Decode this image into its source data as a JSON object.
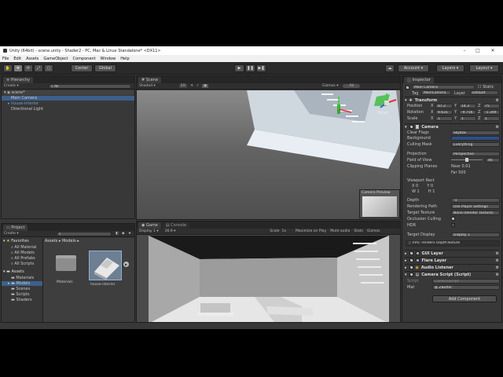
{
  "window": {
    "title": "Unity (64bit) - scene.unity - Shader2 - PC, Mac & Linux Standalone* <DX11>"
  },
  "menu": [
    "File",
    "Edit",
    "Assets",
    "GameObject",
    "Component",
    "Window",
    "Help"
  ],
  "toolbar": {
    "center": "Center",
    "global": "Global",
    "account": "Account",
    "layers": "Layers",
    "layout": "Layout"
  },
  "hierarchy": {
    "tab": "Hierarchy",
    "create": "Create",
    "search_placeholder": "All",
    "scene": "scene*",
    "items": [
      "Main Camera",
      "house-interior",
      "Directional Light"
    ]
  },
  "scene_view": {
    "tab": "Scene",
    "shading": "Shaded",
    "gizmos": "Gizmos",
    "gizmos_filter": "All",
    "persp": "Persp",
    "camera_preview": "Camera Preview"
  },
  "game_view": {
    "tabs": [
      "Game",
      "Console"
    ],
    "display": "Display 1",
    "aspect": "16:9",
    "scale": "1x",
    "options": [
      "Maximize on Play",
      "Mute audio",
      "Stats",
      "Gizmos"
    ]
  },
  "project": {
    "tab": "Project",
    "create": "Create",
    "favorites_label": "Favorites",
    "favorites": [
      "All Material",
      "All Models",
      "All Prefabs",
      "All Scripts"
    ],
    "assets_label": "Assets",
    "assets": [
      "Materials",
      "Models",
      "Scenes",
      "Scripts",
      "Shaders"
    ],
    "breadcrumb": [
      "Assets",
      "Models"
    ],
    "files": [
      "Materials",
      "house-interior"
    ]
  },
  "inspector": {
    "tab": "Inspector",
    "object_name": "Main Camera",
    "static": "Static",
    "tag_label": "Tag",
    "tag": "MainCamera",
    "layer_label": "Layer",
    "layer": "Default",
    "transform": {
      "title": "Transform",
      "position_label": "Position",
      "rotation_label": "Rotation",
      "scale_label": "Scale",
      "position": [
        "87.2",
        "14.3",
        "75"
      ],
      "rotation": [
        "9.631",
        "-9.756",
        "-1.349"
      ],
      "scale": [
        "1",
        "1",
        "1"
      ]
    },
    "camera": {
      "title": "Camera",
      "fields": [
        {
          "label": "Clear Flags",
          "value": "Skybox"
        },
        {
          "label": "Background",
          "value": ""
        },
        {
          "label": "Culling Mask",
          "value": "Everything"
        },
        {
          "label": "Projection",
          "value": "Perspective"
        },
        {
          "label": "Field of View",
          "value": "46"
        },
        {
          "label": "Clipping Planes",
          "value": "Near  0.01"
        },
        {
          "label": "",
          "value": "Far   500"
        },
        {
          "label": "Viewport Rect",
          "value": ""
        },
        {
          "label": "",
          "value": "X 0       Y 0"
        },
        {
          "label": "",
          "value": "W 1       H 1"
        },
        {
          "label": "Depth",
          "value": "-1"
        },
        {
          "label": "Rendering Path",
          "value": "Use Player Settings"
        },
        {
          "label": "Target Texture",
          "value": "None (Render Texture)"
        },
        {
          "label": "Occlusion Culling",
          "value": "✓"
        },
        {
          "label": "HDR",
          "value": ""
        },
        {
          "label": "Target Display",
          "value": "Display 1"
        }
      ],
      "info": "Info: renders DepthTexture"
    },
    "components": [
      "GUI Layer",
      "Flare Layer",
      "Audio Listener",
      "Camera Script (Script)"
    ],
    "script_label": "Script",
    "script_value": "CameraScript",
    "mat_label": "Mat",
    "mat_value": "ZBuffer",
    "add_component": "Add Component"
  }
}
